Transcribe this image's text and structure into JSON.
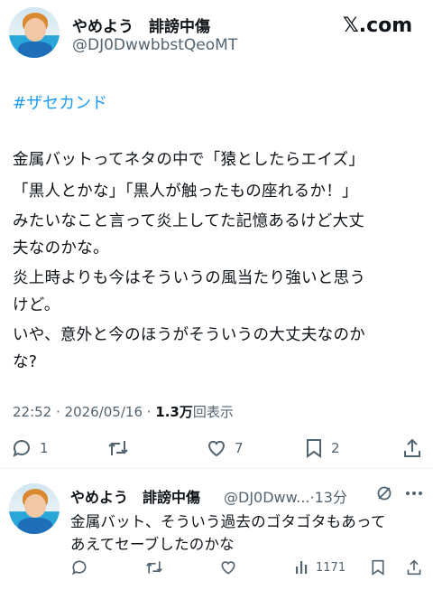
{
  "header": {
    "display_name": "やめよう　誹謗中傷",
    "handle": "@DJ0DwwbbstQeoMT",
    "site_logo": "𝕏.com"
  },
  "tweet": {
    "hashtag": "#ザセカンド",
    "lines": [
      "金属バットってネタの中で「猿としたらエイズ」",
      "「黒人とかな」「黒人が触ったもの座れるか！」",
      "みたいなこと言って炎上してた記憶あるけど大丈",
      "夫なのかな。",
      "炎上時よりも今はそういうの風当たり強いと思う",
      "けど。",
      "いや、意外と今のほうがそういうの大丈夫なのか",
      "な?"
    ],
    "time": "22:52 · 2026/05/16 · ",
    "views_count": "1.3万",
    "views_label": "回表示",
    "actions": {
      "reply_count": "1",
      "retweet_count": "",
      "like_count": "7",
      "bookmark_count": "2"
    }
  },
  "reply": {
    "display_name": "やめよう　誹謗中傷",
    "handle_time": "@DJ0Dww...·13分",
    "lines": [
      "金属バット、そういう過去のゴタゴタもあって",
      "あえてセーブしたのかな"
    ],
    "actions": {
      "views_count": "1171"
    }
  },
  "icons": [
    "reply-icon",
    "retweet-icon",
    "like-icon",
    "bookmark-icon",
    "share-icon",
    "views-icon",
    "grok-icon",
    "more-icon"
  ],
  "colors": {
    "text": "#0f1419",
    "secondary": "#536471",
    "link": "#1d9bf0",
    "divider": "#eff3f4"
  }
}
